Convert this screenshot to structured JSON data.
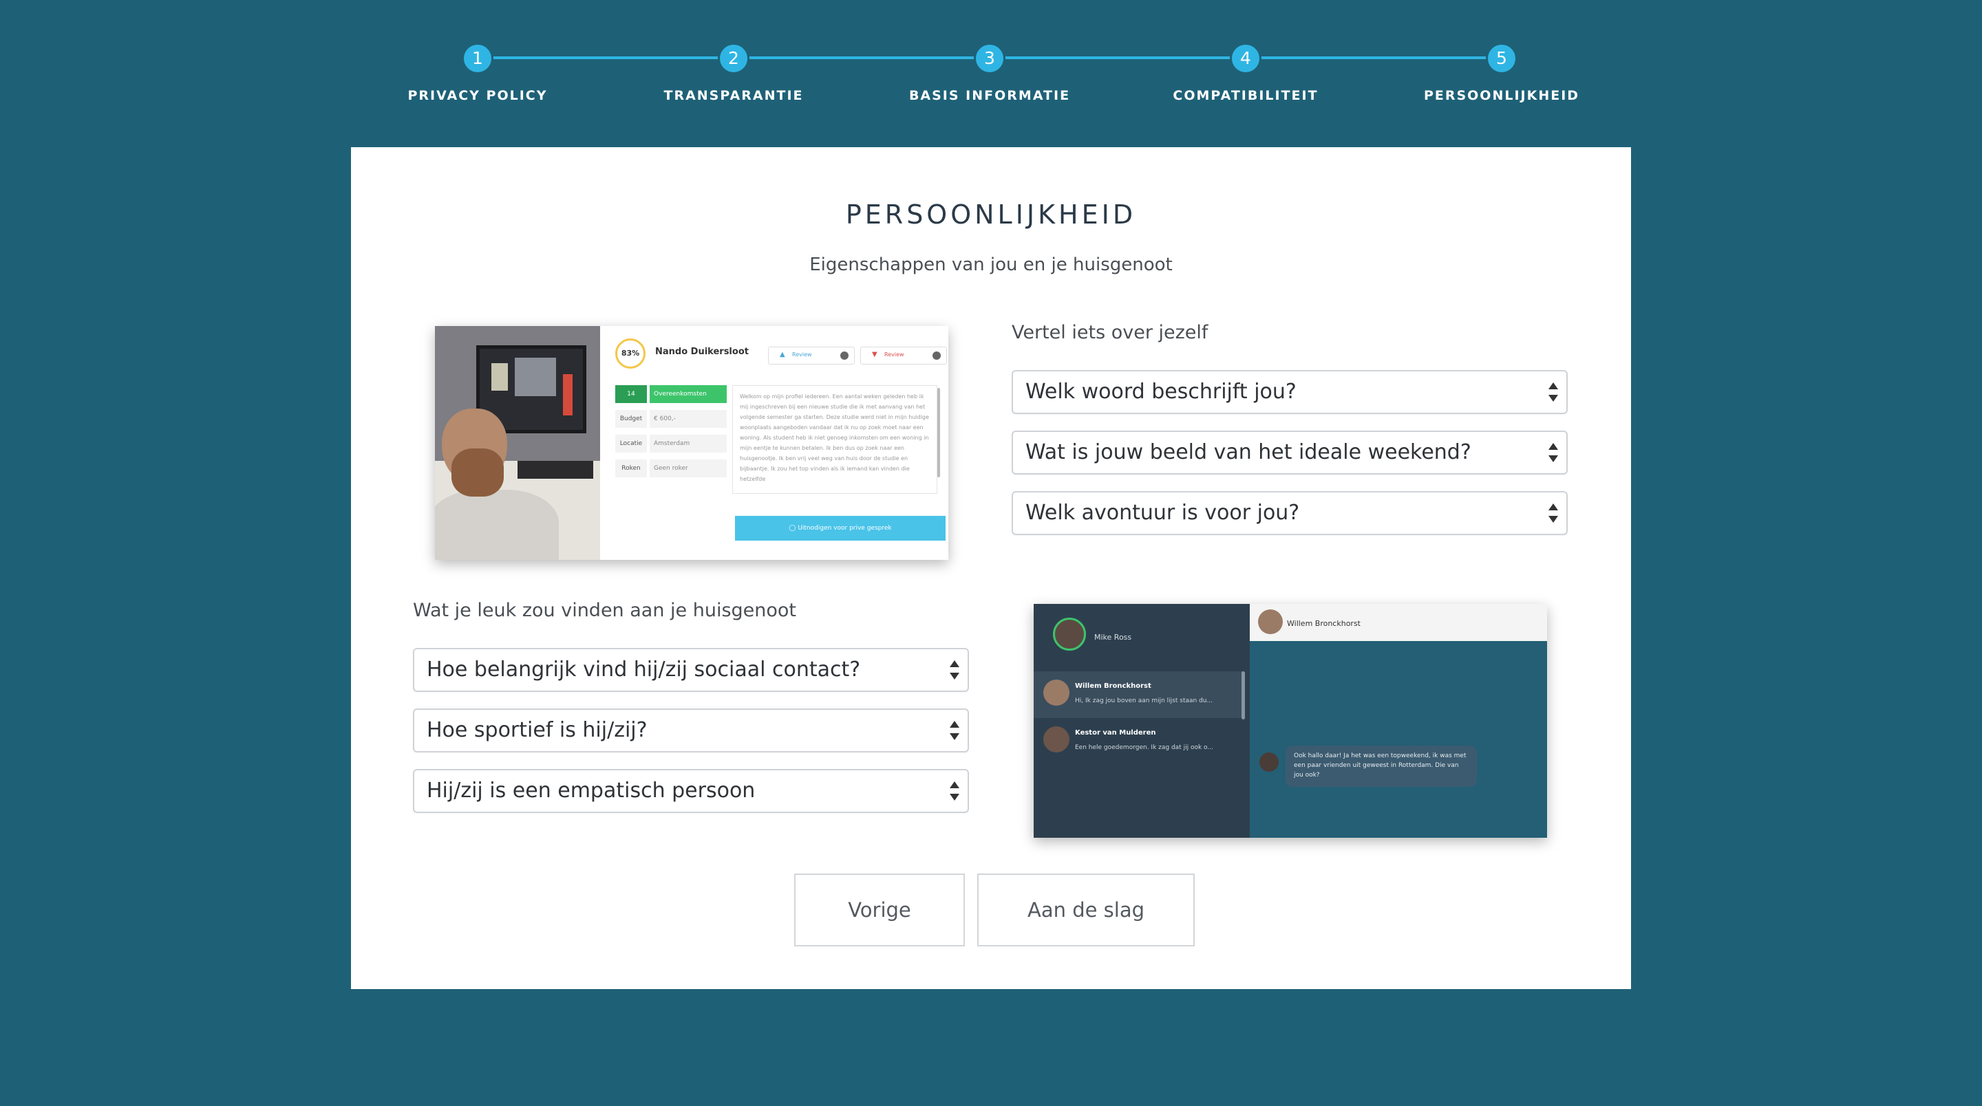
{
  "stepper": {
    "steps": [
      {
        "number": "1",
        "label": "PRIVACY POLICY"
      },
      {
        "number": "2",
        "label": "TRANSPARANTIE"
      },
      {
        "number": "3",
        "label": "BASIS INFORMATIE"
      },
      {
        "number": "4",
        "label": "COMPATIBILITEIT"
      },
      {
        "number": "5",
        "label": "PERSOONLIJKHEID"
      }
    ],
    "active_step": 5,
    "accent_color": "#2fb5e4"
  },
  "card": {
    "title": "PERSOONLIJKHEID",
    "subtitle": "Eigenschappen van jou en je huisgenoot"
  },
  "self_section": {
    "label": "Vertel iets over jezelf",
    "selects": [
      "Welk woord beschrijft jou?",
      "Wat is jouw beeld van het ideale weekend?",
      "Welk avontuur is voor jou?"
    ]
  },
  "roommate_section": {
    "label": "Wat je leuk zou vinden aan je huisgenoot",
    "selects": [
      "Hoe belangrijk vind hij/zij sociaal contact?",
      "Hoe sportief is hij/zij?",
      "Hij/zij is een empatisch persoon"
    ]
  },
  "profile_preview": {
    "match_percent": "83%",
    "name": "Nando Duikersloot",
    "review_positive": "Review",
    "review_negative": "Review",
    "rows": [
      {
        "key": "14",
        "value": "Overeenkomsten"
      },
      {
        "key": "Budget",
        "value": "€ 600,-"
      },
      {
        "key": "Locatie",
        "value": "Amsterdam"
      },
      {
        "key": "Roken",
        "value": "Geen roker"
      }
    ],
    "bio": "Welkom op mijn profiel iedereen. Een aantal weken geleden heb ik mij ingeschreven bij een nieuwe studie die ik met aanvang van het volgende semester ga starten. Deze studie werd niet in mijn huidige woonplaats aangeboden vandaar dat ik nu op zoek moet naar een woning. Als student heb ik niet genoeg inkomsten om een woning in mijn eentje te kunnen betalen. Ik ben dus op zoek naar een huisgenootje. Ik ben vrij veel weg van huis door de studie en bijbaantje. Ik zou het top vinden als ik iemand kan vinden die hetzelfde",
    "invite_button": "Uitnodigen voor prive gesprek"
  },
  "chat_preview": {
    "me": "Mike Ross",
    "header_name": "Willem Bronckhorst",
    "conversations": [
      {
        "name": "Willem Bronckhorst",
        "message": "Hi, Ik zag jou boven aan mijn lijst staan du..."
      },
      {
        "name": "Kestor van Mulderen",
        "message": "Een hele goedemorgen. Ik zag dat jij ook o..."
      }
    ],
    "bubble": "Ook hallo daar! Ja het was een topweekend, ik was met een paar vrienden uit geweest in Rotterdam. Die van jou ook?"
  },
  "buttons": {
    "previous": "Vorige",
    "start": "Aan de slag"
  },
  "colors": {
    "background": "#1e6177",
    "card": "#ffffff",
    "accent": "#2fb5e4"
  }
}
